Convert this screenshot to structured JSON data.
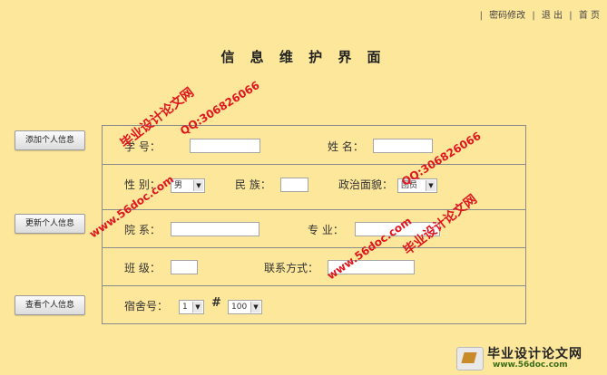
{
  "nav": {
    "sep": "|",
    "change_password": "密码修改",
    "logout": "退 出",
    "home": "首 页"
  },
  "title": "信 息 维 护 界 面",
  "side_buttons": {
    "add": "添加个人信息",
    "update": "更新个人信息",
    "view": "查看个人信息"
  },
  "form": {
    "student_id_label": "学 号：",
    "name_label": "姓  名：",
    "gender_label": "性  别：",
    "gender_value": "男",
    "ethnicity_label": "民  族：",
    "political_label": "政治面貌：",
    "political_value": "团员",
    "dept_label": "院  系：",
    "major_label": "专  业：",
    "class_label": "班  级：",
    "contact_label": "联系方式：",
    "dorm_label": "宿舍号：",
    "dorm_building": "1",
    "hash": "#",
    "dorm_room": "100"
  },
  "watermarks": {
    "site": "毕业设计论文网",
    "qq": "QQ:306826066",
    "url": "www.56doc.com"
  },
  "logo": {
    "name": "毕业设计论文网",
    "url": "www.56doc.com"
  },
  "colors": {
    "background": "#fde79a",
    "watermark": "#e0161e"
  }
}
